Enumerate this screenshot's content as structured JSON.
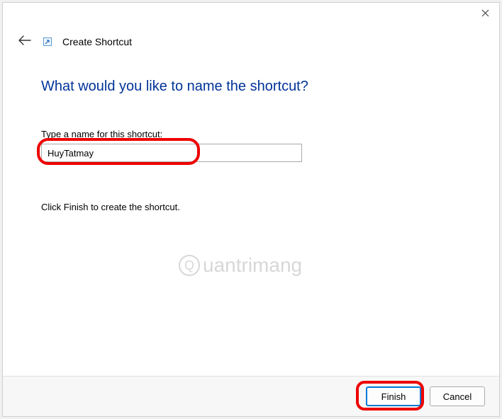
{
  "header": {
    "title": "Create Shortcut"
  },
  "content": {
    "heading": "What would you like to name the shortcut?",
    "field_label": "Type a name for this shortcut:",
    "input_value": "HuyTatmay",
    "help_text": "Click Finish to create the shortcut."
  },
  "footer": {
    "finish_label": "Finish",
    "cancel_label": "Cancel"
  },
  "watermark": {
    "text": "uantrimang"
  }
}
